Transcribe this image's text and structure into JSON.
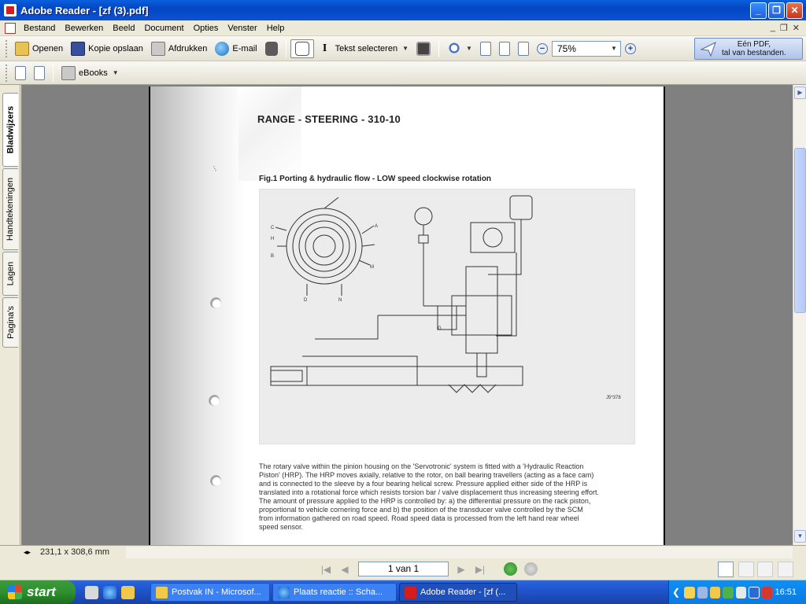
{
  "window": {
    "title": "Adobe Reader - [zf (3).pdf]",
    "minimize": "_",
    "restore": "❐",
    "close": "✕"
  },
  "menu": {
    "items": [
      "Bestand",
      "Bewerken",
      "Beeld",
      "Document",
      "Opties",
      "Venster",
      "Help"
    ],
    "doc_controls": [
      "_",
      "❐",
      "✕"
    ]
  },
  "toolbar": {
    "open": "Openen",
    "save_copy": "Kopie opslaan",
    "print": "Afdrukken",
    "email": "E-mail",
    "text_select": "Tekst selecteren",
    "zoom_value": "75%",
    "zoom_out": "−",
    "zoom_in": "+",
    "promo_line1": "Eén PDF,",
    "promo_line2": "tal van bestanden.",
    "ebooks": "eBooks"
  },
  "side_tabs": [
    "Bladwijzers",
    "Handtekeningen",
    "Lagen",
    "Pagina's"
  ],
  "document": {
    "heading": "RANGE - STEERING - 310-10",
    "figure_caption": "Fig.1 Porting & hydraulic flow - LOW speed clockwise rotation",
    "figure_code": "J5*378",
    "diagram_labels": [
      "C",
      "H",
      "B",
      "A",
      "D",
      "N",
      "M",
      "G"
    ],
    "body_lines": [
      "The rotary valve within the pinion housing on the 'Servotronic' system is fitted with a 'Hydraulic Reaction",
      "Piston' (HRP). The HRP moves axially, relative to the rotor, on ball bearing travellers (acting as a face cam)",
      "and is connected to the sleeve by a four bearing helical screw. Pressure applied either side of the HRP is",
      "translated into a rotational force which resists torsion bar / valve displacement thus increasing steering effort.",
      "The amount of pressure applied to the HRP is controlled by: a) the differential pressure on the rack piston,",
      "proportional to vehicle cornering force and b) the position of the transducer valve controlled by the SCM",
      "from information gathered on road speed. Road speed data is processed from the left hand rear wheel",
      "speed sensor."
    ]
  },
  "status": {
    "page_size": "231,1 x 308,6 mm"
  },
  "navigation": {
    "page_indicator": "1 van 1"
  },
  "taskbar": {
    "start": "start",
    "tasks": [
      "Postvak IN - Microsof...",
      "Plaats reactie :: Scha...",
      "Adobe Reader - [zf (..."
    ],
    "clock": "16:51"
  },
  "colors": {
    "titlebar": "#0a52d6",
    "taskbar": "#245edb",
    "start_button": "#2f8f2f",
    "doc_background": "#808080"
  }
}
